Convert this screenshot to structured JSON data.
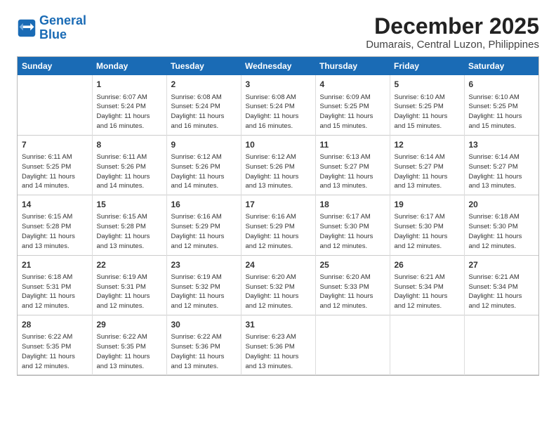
{
  "logo": {
    "line1": "General",
    "line2": "Blue"
  },
  "title": "December 2025",
  "location": "Dumarais, Central Luzon, Philippines",
  "days_header": [
    "Sunday",
    "Monday",
    "Tuesday",
    "Wednesday",
    "Thursday",
    "Friday",
    "Saturday"
  ],
  "weeks": [
    [
      {
        "day": "",
        "info": ""
      },
      {
        "day": "1",
        "info": "Sunrise: 6:07 AM\nSunset: 5:24 PM\nDaylight: 11 hours\nand 16 minutes."
      },
      {
        "day": "2",
        "info": "Sunrise: 6:08 AM\nSunset: 5:24 PM\nDaylight: 11 hours\nand 16 minutes."
      },
      {
        "day": "3",
        "info": "Sunrise: 6:08 AM\nSunset: 5:24 PM\nDaylight: 11 hours\nand 16 minutes."
      },
      {
        "day": "4",
        "info": "Sunrise: 6:09 AM\nSunset: 5:25 PM\nDaylight: 11 hours\nand 15 minutes."
      },
      {
        "day": "5",
        "info": "Sunrise: 6:10 AM\nSunset: 5:25 PM\nDaylight: 11 hours\nand 15 minutes."
      },
      {
        "day": "6",
        "info": "Sunrise: 6:10 AM\nSunset: 5:25 PM\nDaylight: 11 hours\nand 15 minutes."
      }
    ],
    [
      {
        "day": "7",
        "info": "Sunrise: 6:11 AM\nSunset: 5:25 PM\nDaylight: 11 hours\nand 14 minutes."
      },
      {
        "day": "8",
        "info": "Sunrise: 6:11 AM\nSunset: 5:26 PM\nDaylight: 11 hours\nand 14 minutes."
      },
      {
        "day": "9",
        "info": "Sunrise: 6:12 AM\nSunset: 5:26 PM\nDaylight: 11 hours\nand 14 minutes."
      },
      {
        "day": "10",
        "info": "Sunrise: 6:12 AM\nSunset: 5:26 PM\nDaylight: 11 hours\nand 13 minutes."
      },
      {
        "day": "11",
        "info": "Sunrise: 6:13 AM\nSunset: 5:27 PM\nDaylight: 11 hours\nand 13 minutes."
      },
      {
        "day": "12",
        "info": "Sunrise: 6:14 AM\nSunset: 5:27 PM\nDaylight: 11 hours\nand 13 minutes."
      },
      {
        "day": "13",
        "info": "Sunrise: 6:14 AM\nSunset: 5:27 PM\nDaylight: 11 hours\nand 13 minutes."
      }
    ],
    [
      {
        "day": "14",
        "info": "Sunrise: 6:15 AM\nSunset: 5:28 PM\nDaylight: 11 hours\nand 13 minutes."
      },
      {
        "day": "15",
        "info": "Sunrise: 6:15 AM\nSunset: 5:28 PM\nDaylight: 11 hours\nand 13 minutes."
      },
      {
        "day": "16",
        "info": "Sunrise: 6:16 AM\nSunset: 5:29 PM\nDaylight: 11 hours\nand 12 minutes."
      },
      {
        "day": "17",
        "info": "Sunrise: 6:16 AM\nSunset: 5:29 PM\nDaylight: 11 hours\nand 12 minutes."
      },
      {
        "day": "18",
        "info": "Sunrise: 6:17 AM\nSunset: 5:30 PM\nDaylight: 11 hours\nand 12 minutes."
      },
      {
        "day": "19",
        "info": "Sunrise: 6:17 AM\nSunset: 5:30 PM\nDaylight: 11 hours\nand 12 minutes."
      },
      {
        "day": "20",
        "info": "Sunrise: 6:18 AM\nSunset: 5:30 PM\nDaylight: 11 hours\nand 12 minutes."
      }
    ],
    [
      {
        "day": "21",
        "info": "Sunrise: 6:18 AM\nSunset: 5:31 PM\nDaylight: 11 hours\nand 12 minutes."
      },
      {
        "day": "22",
        "info": "Sunrise: 6:19 AM\nSunset: 5:31 PM\nDaylight: 11 hours\nand 12 minutes."
      },
      {
        "day": "23",
        "info": "Sunrise: 6:19 AM\nSunset: 5:32 PM\nDaylight: 11 hours\nand 12 minutes."
      },
      {
        "day": "24",
        "info": "Sunrise: 6:20 AM\nSunset: 5:32 PM\nDaylight: 11 hours\nand 12 minutes."
      },
      {
        "day": "25",
        "info": "Sunrise: 6:20 AM\nSunset: 5:33 PM\nDaylight: 11 hours\nand 12 minutes."
      },
      {
        "day": "26",
        "info": "Sunrise: 6:21 AM\nSunset: 5:34 PM\nDaylight: 11 hours\nand 12 minutes."
      },
      {
        "day": "27",
        "info": "Sunrise: 6:21 AM\nSunset: 5:34 PM\nDaylight: 11 hours\nand 12 minutes."
      }
    ],
    [
      {
        "day": "28",
        "info": "Sunrise: 6:22 AM\nSunset: 5:35 PM\nDaylight: 11 hours\nand 12 minutes."
      },
      {
        "day": "29",
        "info": "Sunrise: 6:22 AM\nSunset: 5:35 PM\nDaylight: 11 hours\nand 13 minutes."
      },
      {
        "day": "30",
        "info": "Sunrise: 6:22 AM\nSunset: 5:36 PM\nDaylight: 11 hours\nand 13 minutes."
      },
      {
        "day": "31",
        "info": "Sunrise: 6:23 AM\nSunset: 5:36 PM\nDaylight: 11 hours\nand 13 minutes."
      },
      {
        "day": "",
        "info": ""
      },
      {
        "day": "",
        "info": ""
      },
      {
        "day": "",
        "info": ""
      }
    ]
  ]
}
